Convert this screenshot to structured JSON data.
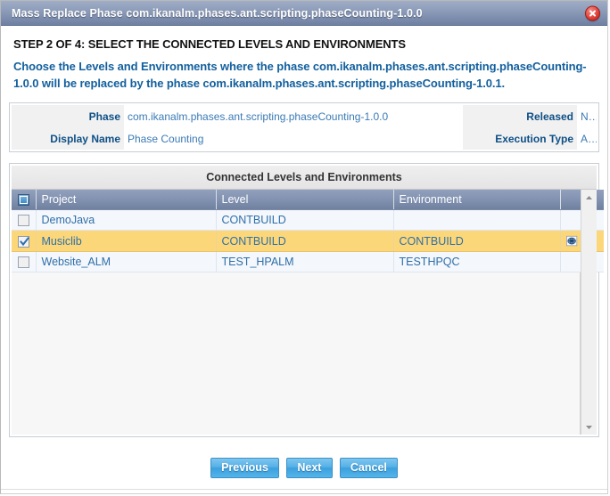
{
  "window": {
    "title": "Mass Replace Phase com.ikanalm.phases.ant.scripting.phaseCounting-1.0.0",
    "close_label": "close-icon"
  },
  "step": {
    "heading": "STEP 2 OF 4: SELECT THE CONNECTED LEVELS AND ENVIRONMENTS",
    "description": "Choose the Levels and Environments where the phase com.ikanalm.phases.ant.scripting.phaseCounting-1.0.0 will be replaced by the phase com.ikanalm.phases.ant.scripting.phaseCounting-1.0.1."
  },
  "info": {
    "phase_label": "Phase",
    "phase_value": "com.ikanalm.phases.ant.scripting.phaseCounting-1.0.0",
    "released_label": "Released",
    "released_value": "No",
    "display_name_label": "Display Name",
    "display_name_value": "Phase Counting",
    "execution_type_label": "Execution Type",
    "execution_type_value": "ANT"
  },
  "grid": {
    "caption": "Connected Levels and Environments",
    "columns": [
      "Project",
      "Level",
      "Environment"
    ],
    "rows": [
      {
        "checked": false,
        "selected": false,
        "project": "DemoJava",
        "level": "CONTBUILD",
        "environment": "",
        "icon": ""
      },
      {
        "checked": true,
        "selected": true,
        "project": "Musiclib",
        "level": "CONTBUILD",
        "environment": "CONTBUILD",
        "icon": "globe-icon"
      },
      {
        "checked": false,
        "selected": false,
        "project": "Website_ALM",
        "level": "TEST_HPALM",
        "environment": "TESTHPQC",
        "icon": ""
      }
    ],
    "scrollbar": {
      "up_label": "scroll-up",
      "down_label": "scroll-down"
    }
  },
  "footer": {
    "previous_label": "Previous",
    "next_label": "Next",
    "cancel_label": "Cancel"
  },
  "colors": {
    "titlebar": "#7f8fad",
    "accent_blue": "#12609e",
    "link_blue": "#2e6fa8",
    "selected_row": "#fcd779",
    "button_blue": "#56b0e6",
    "close_red": "#e2453c"
  }
}
